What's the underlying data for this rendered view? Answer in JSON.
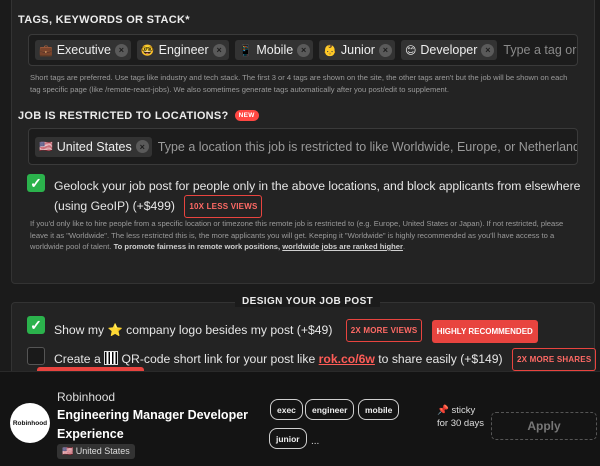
{
  "tags_section": {
    "label": "TAGS, KEYWORDS OR STACK*",
    "chips": [
      {
        "emoji": "💼",
        "label": "Executive"
      },
      {
        "emoji": "🤓",
        "label": "Engineer"
      },
      {
        "emoji": "📱",
        "label": "Mobile"
      },
      {
        "emoji": "👶",
        "label": "Junior"
      },
      {
        "emoji": "😊",
        "label": "Developer"
      }
    ],
    "placeholder": "Type a tag or keywor",
    "help": "Short tags are preferred. Use tags like industry and tech stack. The first 3 or 4 tags are shown on the site, the other tags aren't but the job will be shown on each tag specific page (like /remote-react-jobs). We also sometimes generate tags automatically after you post/edit to supplement."
  },
  "location_section": {
    "label": "JOB IS RESTRICTED TO LOCATIONS?",
    "new_badge": "NEW",
    "chip": {
      "emoji": "🇺🇸",
      "label": "United States"
    },
    "placeholder": "Type a location this job is restricted to like Worldwide, Europe, or Netherlands",
    "geolock_text": "Geolock your job post for people only in the above locations, and block applicants from elsewhere (using GeoIP) (+$499)",
    "geolock_badge": "10X LESS VIEWS",
    "help_plain": "If you'd only like to hire people from a specific location or timezone this remote job is restricted to (e.g. Europe, United States or Japan). If not restricted, please leave it as \"Worldwide\". The less restricted this is, the more applicants you will get. Keeping it \"Worldwide\" is highly recommended as you'll have access to a worldwide pool of talent.",
    "help_bold": "To promote fairness in remote work positions,",
    "help_underline": "worldwide jobs are ranked higher"
  },
  "design_section": {
    "title": "DESIGN YOUR JOB POST",
    "logo_option": {
      "prefix": "Show my",
      "emoji": "⭐",
      "suffix": "company logo besides my post (+$49)",
      "badge1": "2X MORE VIEWS",
      "badge2": "HIGHLY RECOMMENDED"
    },
    "qr_option": {
      "prefix": "Create a",
      "middle": "QR-code short link for your post like",
      "link": "rok.co/6w",
      "suffix": "to share easily (+$149)",
      "badge": "2X MORE SHARES"
    }
  },
  "preview": {
    "logo_text": "Robinhood",
    "company": "Robinhood",
    "title": "Engineering Manager Developer Experience",
    "location": "🇺🇸 United States",
    "tags": [
      "exec",
      "engineer",
      "mobile",
      "junior"
    ],
    "more": "...",
    "sticky": "📌 sticky for 30 days",
    "apply": "Apply"
  },
  "colors": {
    "accent_red": "#e8443f",
    "check_green": "#2bb24c",
    "background": "#1b1b1b"
  }
}
